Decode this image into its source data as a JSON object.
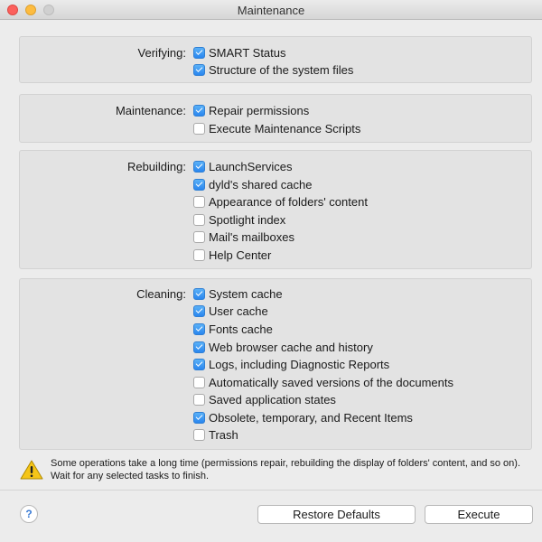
{
  "window": {
    "title": "Maintenance"
  },
  "groups": [
    {
      "label": "Verifying:",
      "items": [
        {
          "label": "SMART Status",
          "checked": true
        },
        {
          "label": "Structure of the system files",
          "checked": true
        }
      ]
    },
    {
      "label": "Maintenance:",
      "items": [
        {
          "label": "Repair permissions",
          "checked": true
        },
        {
          "label": "Execute Maintenance Scripts",
          "checked": false
        }
      ]
    },
    {
      "label": "Rebuilding:",
      "items": [
        {
          "label": "LaunchServices",
          "checked": true
        },
        {
          "label": "dyld's shared cache",
          "checked": true
        },
        {
          "label": "Appearance of folders' content",
          "checked": false
        },
        {
          "label": "Spotlight index",
          "checked": false
        },
        {
          "label": "Mail's mailboxes",
          "checked": false
        },
        {
          "label": "Help Center",
          "checked": false
        }
      ]
    },
    {
      "label": "Cleaning:",
      "items": [
        {
          "label": "System cache",
          "checked": true
        },
        {
          "label": "User cache",
          "checked": true
        },
        {
          "label": "Fonts cache",
          "checked": true
        },
        {
          "label": "Web browser cache and history",
          "checked": true
        },
        {
          "label": "Logs, including Diagnostic Reports",
          "checked": true
        },
        {
          "label": "Automatically saved versions of the documents",
          "checked": false
        },
        {
          "label": "Saved application states",
          "checked": false
        },
        {
          "label": "Obsolete, temporary, and Recent Items",
          "checked": true
        },
        {
          "label": "Trash",
          "checked": false
        }
      ]
    }
  ],
  "warning": {
    "icon": "warning-triangle-icon",
    "text": "Some operations take a long time (permissions repair, rebuilding the display of folders' content, and so on). Wait for any selected tasks to finish."
  },
  "footer": {
    "help": "?",
    "restore_label": "Restore Defaults",
    "execute_label": "Execute"
  },
  "colors": {
    "checkbox_on": "#2a86ef",
    "group_bg": "#e3e3e3",
    "window_bg": "#ececec"
  }
}
